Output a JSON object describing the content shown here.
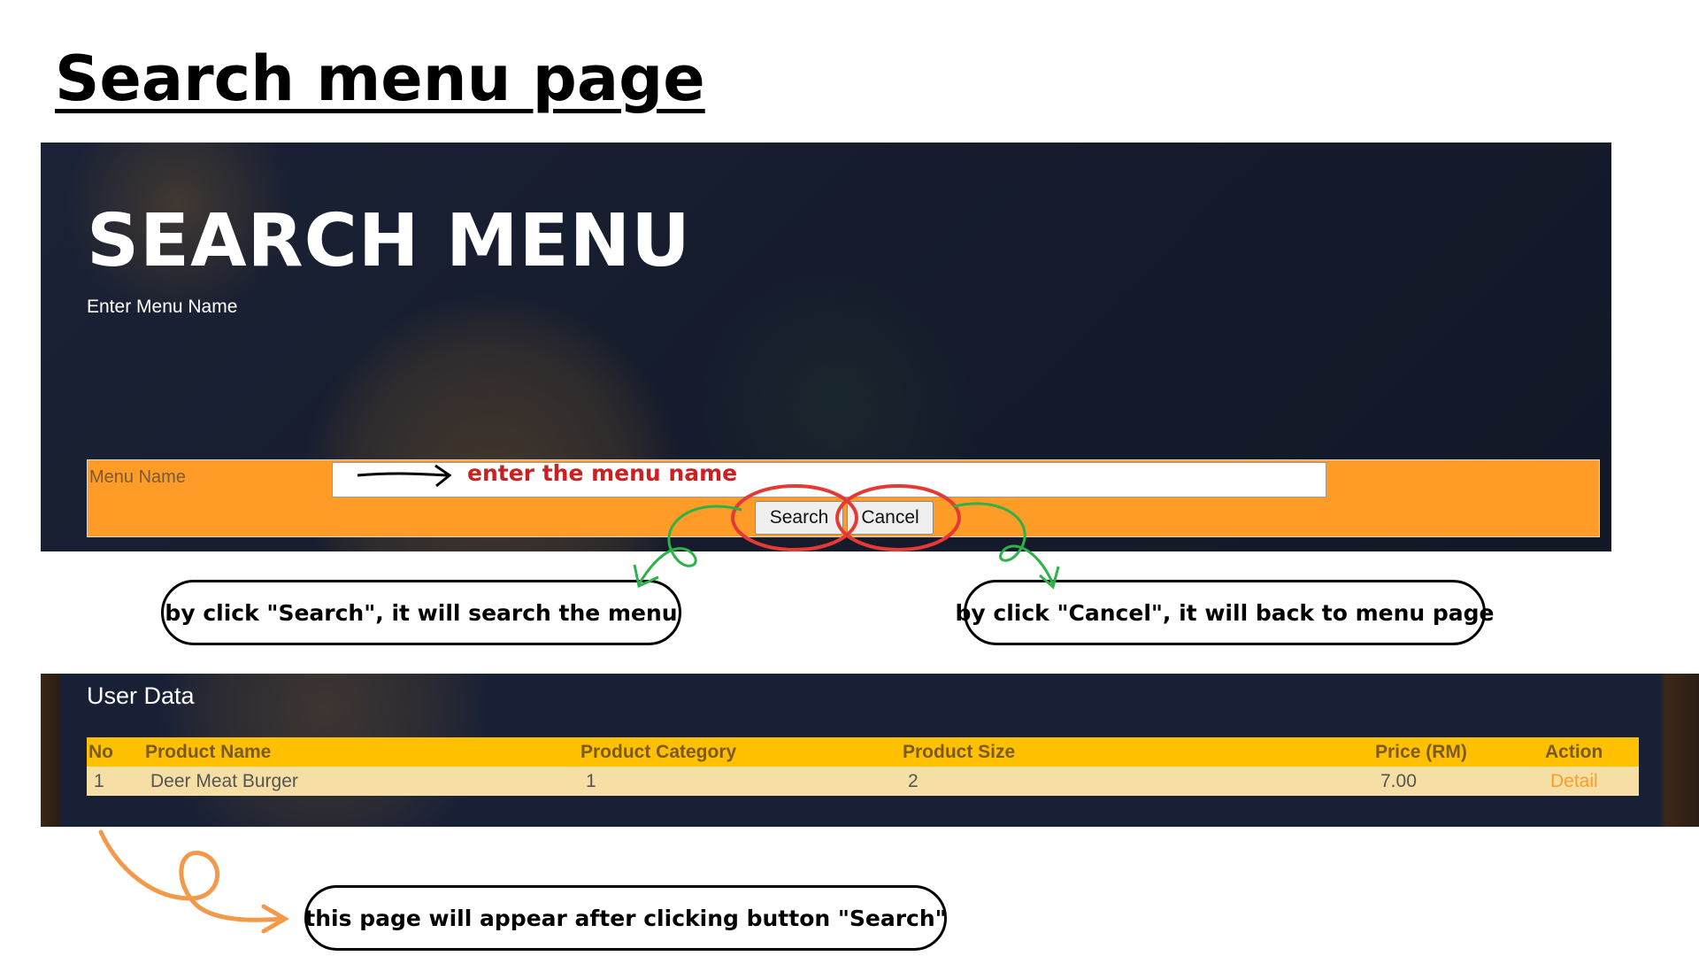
{
  "slide": {
    "title": "Search menu page"
  },
  "search_screen": {
    "heading": "SEARCH MENU",
    "subheading": "Enter Menu Name",
    "form": {
      "label": "Menu Name",
      "input_value": "",
      "search_button": "Search",
      "cancel_button": "Cancel"
    }
  },
  "annotations": {
    "input_hint": "enter the menu name",
    "search_note": "by click \"Search\", it will search the menu",
    "cancel_note": "by click \"Cancel\", it will back to menu page",
    "result_note": "this page will appear after clicking button \"Search\""
  },
  "result_screen": {
    "title": "User Data",
    "columns": [
      "No",
      "Product Name",
      "Product Category",
      "Product Size",
      "Price (RM)",
      "Action"
    ],
    "rows": [
      {
        "no": "1",
        "name": "Deer Meat Burger",
        "category": "1",
        "size": "2",
        "price": "7.00",
        "action": "Detail"
      }
    ]
  },
  "colors": {
    "form_background": "#ff9c27",
    "table_header": "#ffc000",
    "table_row": "#f5dfa5",
    "highlight_circle": "#e53935",
    "arrow_green": "#2bb34a",
    "arrow_orange": "#f29a4a"
  }
}
